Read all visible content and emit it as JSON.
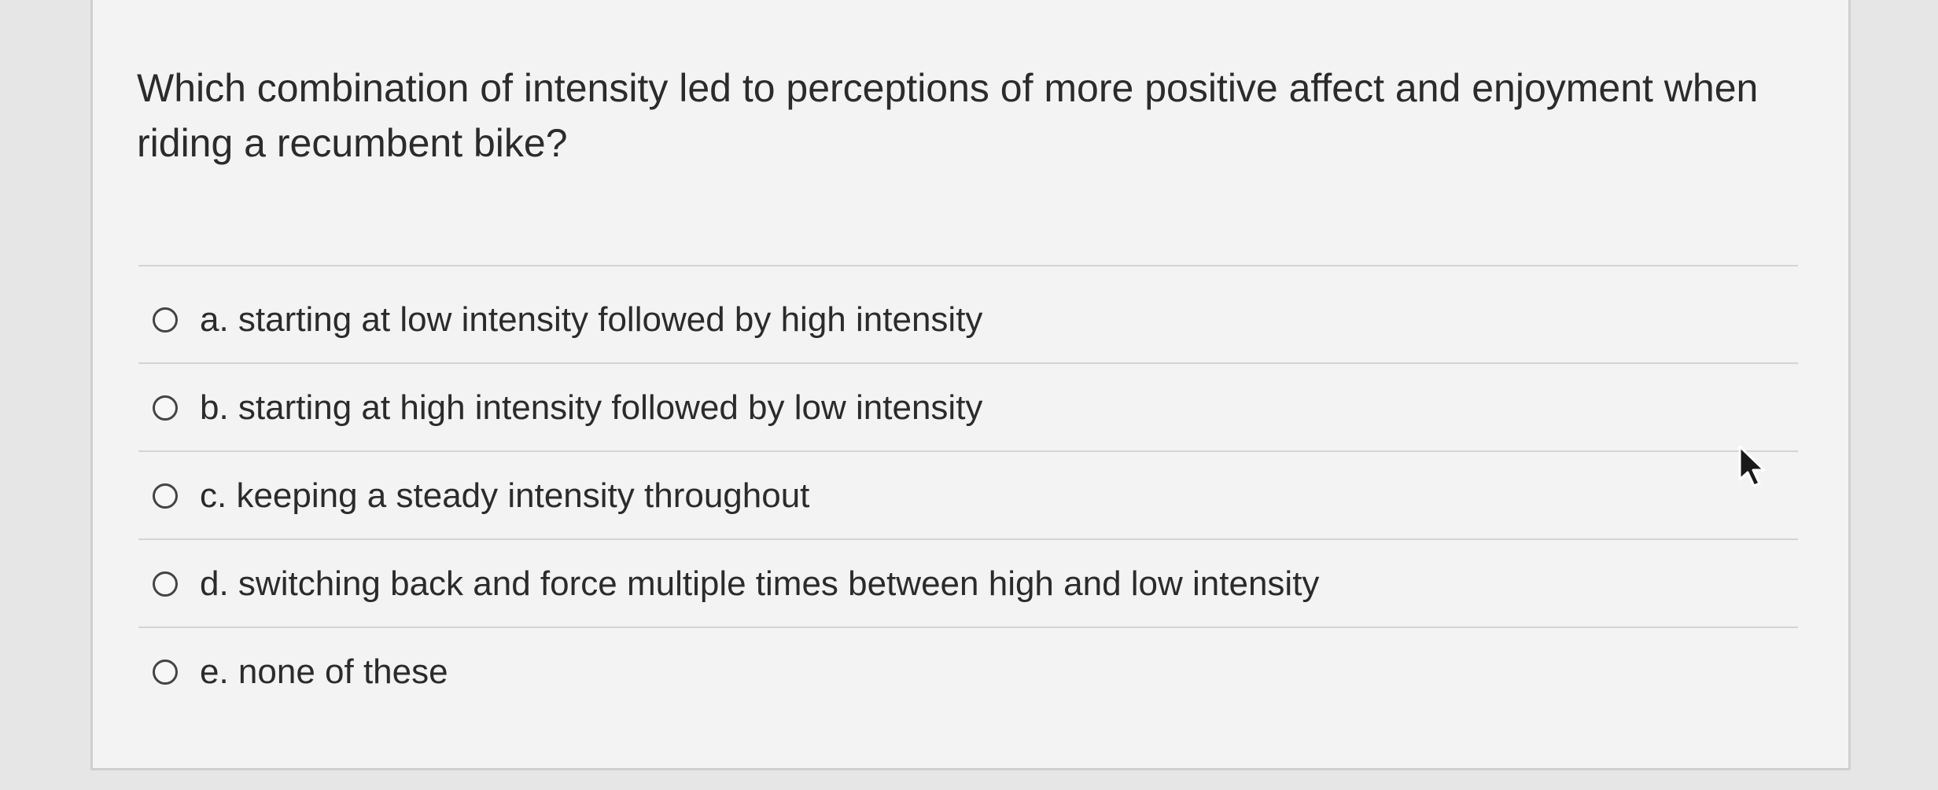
{
  "question": {
    "text": "Which combination of intensity led to perceptions of more positive affect and enjoyment when riding a recumbent bike?"
  },
  "answers": [
    {
      "letter": "a.",
      "text": "a. starting at low intensity followed by high intensity",
      "selected": false
    },
    {
      "letter": "b.",
      "text": "b. starting at high intensity followed by low intensity",
      "selected": false
    },
    {
      "letter": "c.",
      "text": "c. keeping a steady intensity throughout",
      "selected": false
    },
    {
      "letter": "d.",
      "text": "d. switching back and force multiple times between high and low intensity",
      "selected": false
    },
    {
      "letter": "e.",
      "text": "e. none of these",
      "selected": false
    }
  ],
  "colors": {
    "background": "#e6e6e6",
    "card": "#f3f3f3",
    "text": "#2b2b2b",
    "divider": "#d4d4d4"
  },
  "icons": {
    "cursor": "mouse-pointer-icon",
    "radio": "radio-button-empty-icon"
  }
}
